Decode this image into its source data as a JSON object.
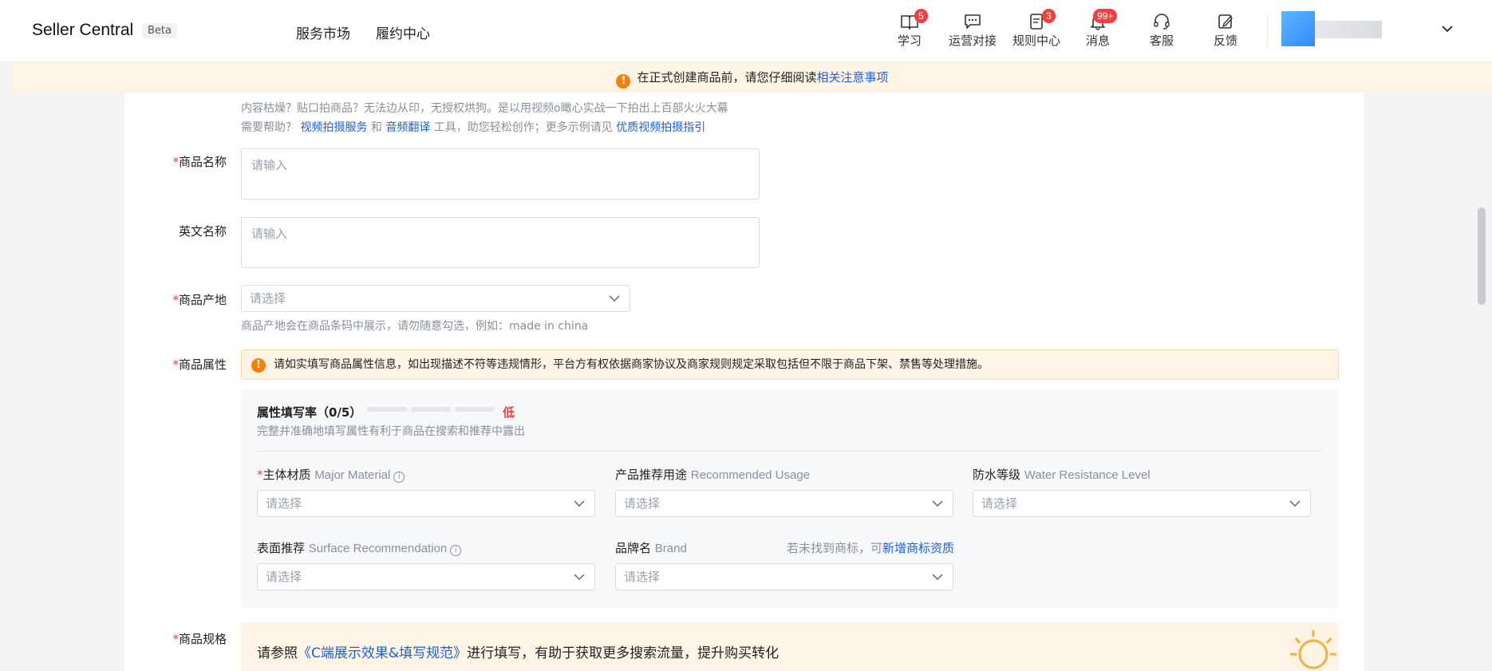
{
  "header": {
    "brand": "Seller Central",
    "beta": "Beta",
    "nav": [
      "服务市场",
      "履约中心"
    ],
    "tools": [
      {
        "label": "学习",
        "badge": "5",
        "icon": "book-icon"
      },
      {
        "label": "运营对接",
        "badge": "",
        "icon": "chat-icon"
      },
      {
        "label": "规则中心",
        "badge": "3",
        "icon": "rules-icon"
      },
      {
        "label": "消息",
        "badge": "99+",
        "icon": "bell-icon"
      },
      {
        "label": "客服",
        "badge": "",
        "icon": "headset-icon"
      },
      {
        "label": "反馈",
        "badge": "",
        "icon": "feedback-icon"
      }
    ]
  },
  "notice": {
    "text": "在正式创建商品前，请您仔细阅读",
    "link": "相关注意事项"
  },
  "video_hint": {
    "line1": "内容枯燥？贴口拍商品？无法边从印，无授权烘狗。是以用视频o瞰心实战一下拍出上百部火火大幕",
    "line2_prefix": "需要帮助？",
    "link1": "视频拍摄服务",
    "and": "和",
    "link2": "音频翻译",
    "line2_mid": "工具，助您轻松创作；更多示例请见",
    "link3": "优质视频拍摄指引"
  },
  "form": {
    "name_label": "商品名称",
    "name_placeholder": "请输入",
    "en_name_label": "英文名称",
    "en_name_placeholder": "请输入",
    "origin_label": "商品产地",
    "origin_placeholder": "请选择",
    "origin_hint": "商品产地会在商品条码中展示，请勿随意勾选，例如：made in china",
    "attr_label": "商品属性",
    "attr_warning": "请如实填写商品属性信息，如出现描述不符等违规情形，平台方有权依据商家协议及商家规则规定采取包括但不限于商品下架、禁售等处理措施。",
    "spec_label": "商品规格"
  },
  "attributes": {
    "rate_title": "属性填写率（0/5）",
    "rate_level": "低",
    "rate_progress": 0,
    "rate_hint": "完整并准确地填写属性有利于商品在搜索和推荐中露出",
    "fields": [
      {
        "cn": "主体材质",
        "en": "Major Material",
        "required": "*",
        "info": "i",
        "placeholder": "请选择"
      },
      {
        "cn": "产品推荐用途",
        "en": "Recommended Usage",
        "required": "",
        "info": "",
        "placeholder": "请选择"
      },
      {
        "cn": "防水等级",
        "en": "Water Resistance Level",
        "required": "",
        "info": "",
        "placeholder": "请选择"
      },
      {
        "cn": "表面推荐",
        "en": "Surface Recommendation",
        "required": "",
        "info": "i",
        "placeholder": "请选择"
      },
      {
        "cn": "品牌名",
        "en": "Brand",
        "required": "",
        "info": "",
        "placeholder": "请选择"
      }
    ],
    "brand_hint": "若未找到商标，可",
    "brand_link": "新增商标资质"
  },
  "spec_banner": {
    "prefix": "请参照",
    "link": "《C端展示效果&填写规范》",
    "suffix": "进行填写，有助于获取更多搜索流量，提升购买转化"
  },
  "colors": {
    "accent_link": "#1f5fd8",
    "required": "#f53f3f",
    "warning": "#ff7d00",
    "notice_bg": "#fdf4e5"
  }
}
